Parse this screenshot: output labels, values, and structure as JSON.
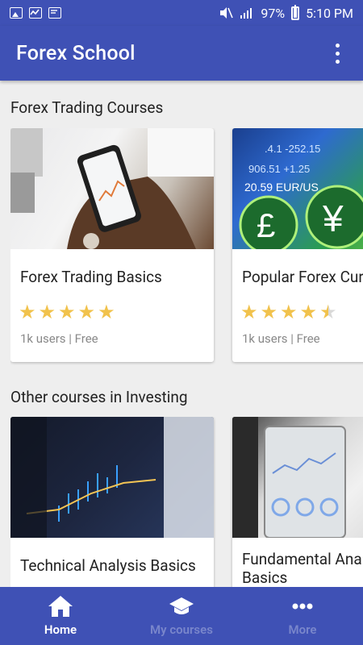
{
  "status_bar": {
    "battery": "97%",
    "time": "5:10 PM",
    "icons": [
      "gallery-icon",
      "activity-icon",
      "document-icon",
      "mute-icon",
      "signal-icon",
      "battery-icon"
    ]
  },
  "app_bar": {
    "title": "Forex School",
    "menu_icon": "more-vert-icon"
  },
  "sections": [
    {
      "title": "Forex Trading Courses",
      "cards": [
        {
          "title": "Forex Trading Basics",
          "rating": 5,
          "meta": "1k users | Free",
          "image": "hand-holding-phone-with-chart"
        },
        {
          "title": "Popular Forex Currencies",
          "rating": 4.5,
          "meta": "1k users | Free",
          "image": "currency-symbols-pound-yen"
        }
      ]
    },
    {
      "title": "Other courses in Investing",
      "cards": [
        {
          "title": "Technical Analysis Basics",
          "image": "candlestick-chart-screen"
        },
        {
          "title": "Fundamental Analysis Basics",
          "image": "tablet-with-analytics"
        }
      ]
    }
  ],
  "bottom_nav": [
    {
      "label": "Home",
      "icon": "home-icon",
      "active": true
    },
    {
      "label": "My courses",
      "icon": "graduation-cap-icon",
      "active": false
    },
    {
      "label": "More",
      "icon": "more-horiz-icon",
      "active": false
    }
  ],
  "colors": {
    "primary": "#3f51b5",
    "star": "#f1c24c",
    "inactive_nav": "#7986cb",
    "background": "#eeeeee"
  }
}
